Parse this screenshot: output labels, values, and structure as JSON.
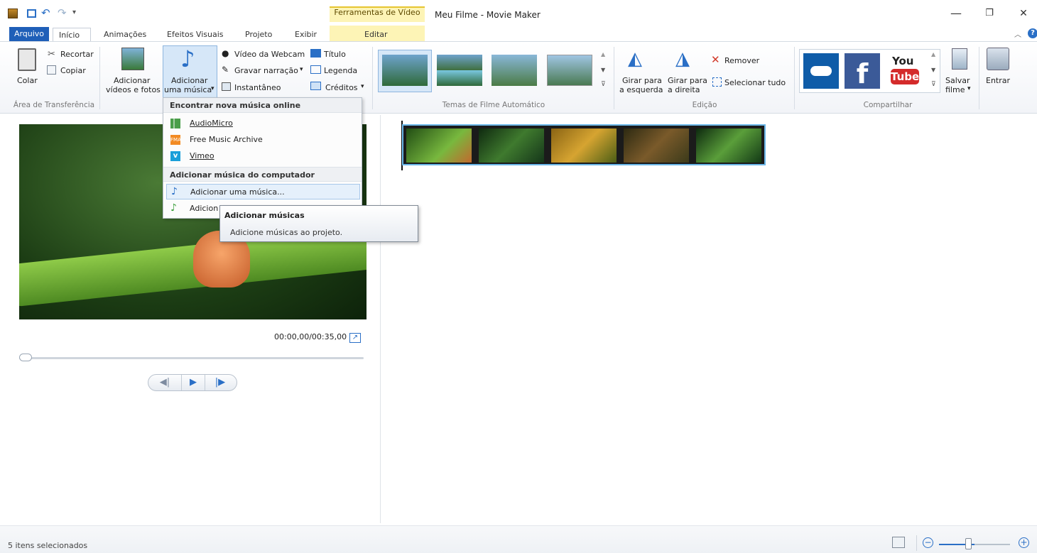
{
  "window": {
    "title": "Meu Filme - Movie Maker",
    "context_tab_group": "Ferramentas de Vídeo",
    "minimize": "—",
    "restore": "❐",
    "close": "✕"
  },
  "tabs": {
    "file": "Arquivo",
    "home": "Início",
    "animations": "Animações",
    "visual_effects": "Efeitos Visuais",
    "project": "Projeto",
    "view": "Exibir",
    "edit": "Editar"
  },
  "ribbon": {
    "clipboard": {
      "paste": "Colar",
      "cut": "Recortar",
      "copy": "Copiar",
      "label": "Área de Transferência"
    },
    "add": {
      "add_videos_line1": "Adicionar",
      "add_videos_line2": "vídeos e fotos",
      "add_music_line1": "Adicionar",
      "add_music_line2": "uma música",
      "webcam": "Vídeo da Webcam",
      "narration": "Gravar narração",
      "snapshot": "Instantâneo",
      "title": "Título",
      "caption": "Legenda",
      "credits": "Créditos"
    },
    "themes_label": "Temas de Filme Automático",
    "editing": {
      "rotate_left_line1": "Girar para",
      "rotate_left_line2": "a esquerda",
      "rotate_right_line1": "Girar para",
      "rotate_right_line2": "a direita",
      "remove": "Remover",
      "select_all": "Selecionar tudo",
      "label": "Edição"
    },
    "share": {
      "youtube_top": "You",
      "youtube_bottom": "Tube",
      "save_movie_line1": "Salvar",
      "save_movie_line2": "filme",
      "sign_in": "Entrar",
      "label": "Compartilhar"
    }
  },
  "menu": {
    "header_online": "Encontrar nova música online",
    "audiomicro": "AudioMicro",
    "fma": "Free Music Archive",
    "vimeo": "Vimeo",
    "header_pc": "Adicionar música do computador",
    "add_one": "Adicionar uma música...",
    "add_at": "Adicion"
  },
  "tooltip": {
    "title": "Adicionar músicas",
    "desc": "Adicione músicas ao projeto."
  },
  "player": {
    "timecode": "00:00,00/00:35,00"
  },
  "status": {
    "text": "5 itens selecionados",
    "zoom_minus": "−",
    "zoom_plus": "+"
  },
  "colors": {
    "accent": "#1f5fb8",
    "context_band": "#fdf4b6",
    "selection": "#6bb7e8"
  }
}
